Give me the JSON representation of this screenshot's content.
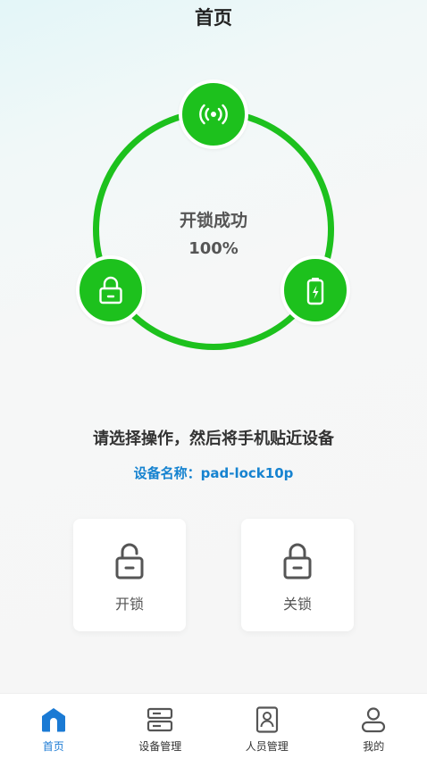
{
  "header": {
    "title": "首页"
  },
  "status": {
    "title": "开锁成功",
    "percent": "100%",
    "progress_fraction": 1.0,
    "nodes": [
      "nfc-signal-icon",
      "lock-icon",
      "battery-charging-icon"
    ]
  },
  "instruction": "请选择操作，然后将手机贴近设备",
  "device": {
    "name_line": "设备名称：pad-lock10p"
  },
  "actions": [
    {
      "label": "开锁",
      "icon": "unlock-icon"
    },
    {
      "label": "关锁",
      "icon": "lock-icon"
    }
  ],
  "tabbar": {
    "items": [
      {
        "label": "首页",
        "icon": "home-icon",
        "active": true
      },
      {
        "label": "设备管理",
        "icon": "device-manage-icon",
        "active": false
      },
      {
        "label": "人员管理",
        "icon": "person-card-icon",
        "active": false
      },
      {
        "label": "我的",
        "icon": "user-icon",
        "active": false
      }
    ]
  },
  "colors": {
    "accent_green": "#1dc11d",
    "link_blue": "#1683d0",
    "tab_active": "#1a7ad4"
  }
}
